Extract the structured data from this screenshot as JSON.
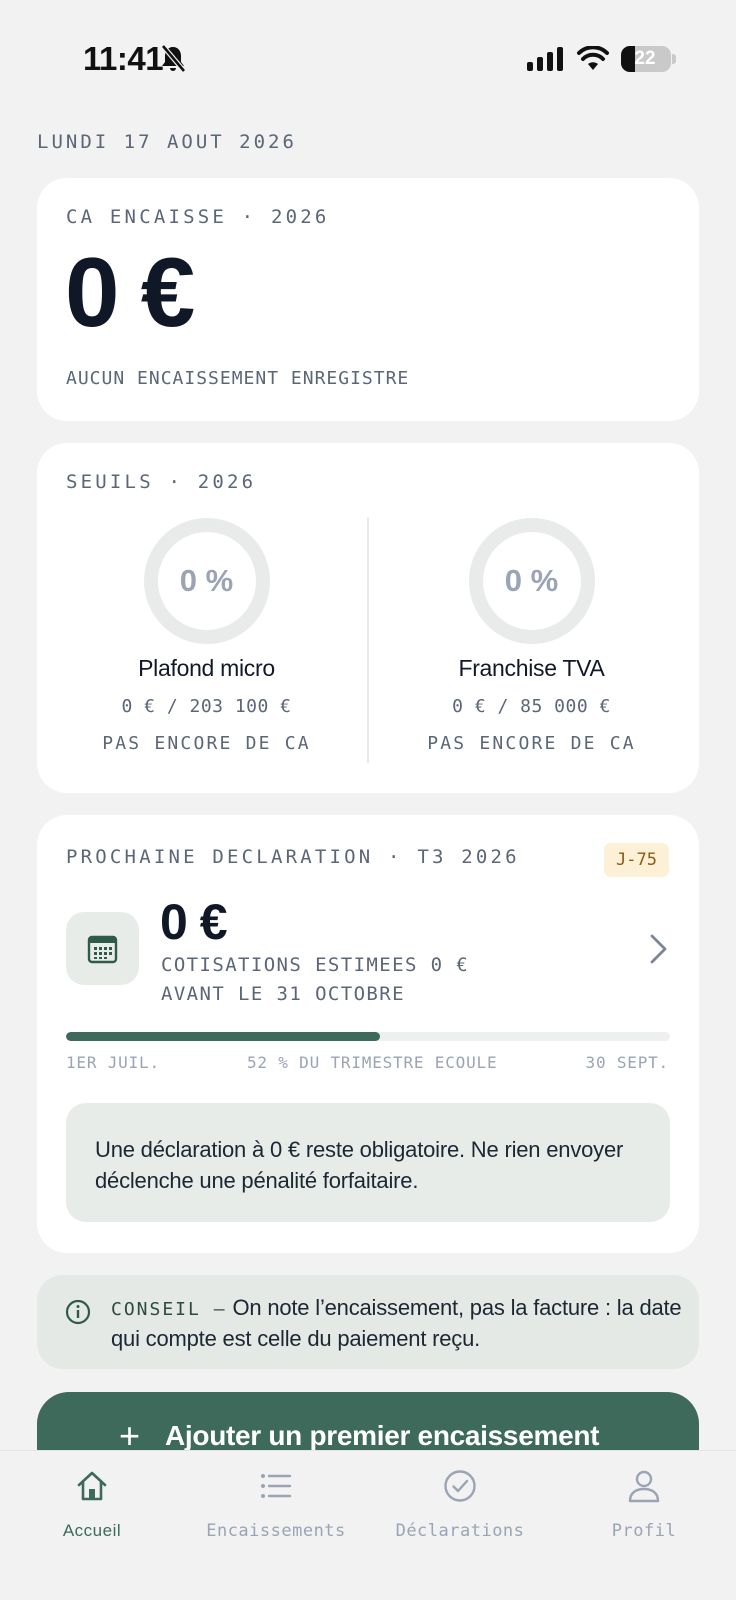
{
  "status_bar": {
    "time": "11:41",
    "battery": "22"
  },
  "date": "LUNDI 17 AOUT 2026",
  "revenue_card": {
    "eyebrow": "CA ENCAISSE · 2026",
    "amount": "0 €",
    "subtitle": "AUCUN ENCAISSEMENT ENREGISTRE"
  },
  "thresholds_card": {
    "eyebrow": "SEUILS · 2026",
    "gauges": [
      {
        "percent_label": "0 %",
        "percent_value": 0,
        "name": "Plafond micro",
        "amount": "0 € / 203 100 €",
        "status": "PAS ENCORE DE CA"
      },
      {
        "percent_label": "0 %",
        "percent_value": 0,
        "name": "Franchise TVA",
        "amount": "0 € / 85 000 €",
        "status": "PAS ENCORE DE CA"
      }
    ]
  },
  "declaration_card": {
    "eyebrow": "PROCHAINE DECLARATION · T3 2026",
    "badge": "J-75",
    "amount": "0 €",
    "line1": "COTISATIONS ESTIMEES 0 €",
    "line2": "AVANT LE 31 OCTOBRE",
    "progress": 0.52,
    "progress_start": "1ER JUIL.",
    "progress_label": "52 % DU TRIMESTRE ECOULE",
    "progress_end": "30 SEPT.",
    "notice": "Une déclaration à 0 € reste obligatoire. Ne rien envoyer déclenche une pénalité forfaitaire."
  },
  "tip": {
    "label": "CONSEIL —",
    "text": "On note l’encaissement, pas la facture : la date qui compte est celle du paiement reçu."
  },
  "cta": {
    "label": "Ajouter un premier encaissement"
  },
  "tabs": [
    {
      "label": "Accueil",
      "icon": "home-icon",
      "active": true
    },
    {
      "label": "Encaissements",
      "icon": "list-icon",
      "active": false
    },
    {
      "label": "Déclarations",
      "icon": "check-circle-icon",
      "active": false
    },
    {
      "label": "Profil",
      "icon": "person-icon",
      "active": false
    }
  ],
  "colors": {
    "accent": "#3d6a5a",
    "badge_bg": "#fcf0d6",
    "badge_text": "#8c5c13",
    "muted": "#5b6677"
  }
}
